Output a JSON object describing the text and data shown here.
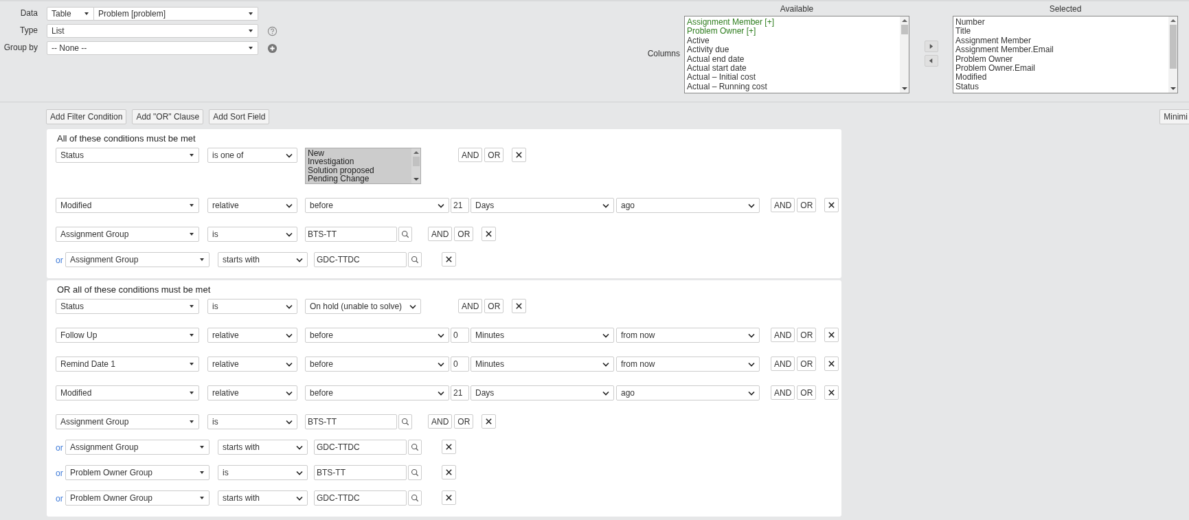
{
  "form": {
    "data": {
      "label": "Data",
      "source": "Table",
      "table": "Problem [problem]"
    },
    "type": {
      "label": "Type",
      "value": "List"
    },
    "group_by": {
      "label": "Group by",
      "value": "-- None --"
    }
  },
  "columns": {
    "label": "Columns",
    "available": {
      "title": "Available",
      "items": [
        {
          "text": "Assignment Member [+]",
          "expandable": true
        },
        {
          "text": "Problem Owner [+]",
          "expandable": true
        },
        {
          "text": "Active",
          "expandable": false
        },
        {
          "text": "Activity due",
          "expandable": false
        },
        {
          "text": "Actual end date",
          "expandable": false
        },
        {
          "text": "Actual start date",
          "expandable": false
        },
        {
          "text": "Actual – Initial cost",
          "expandable": false
        },
        {
          "text": "Actual – Running cost",
          "expandable": false
        }
      ]
    },
    "selected": {
      "title": "Selected",
      "items": [
        "Number",
        "Title",
        "Assignment Member",
        "Assignment Member.Email",
        "Problem Owner",
        "Problem Owner.Email",
        "Modified",
        "Status"
      ]
    }
  },
  "toolbar": [
    "Add Filter Condition",
    "Add \"OR\" Clause",
    "Add Sort Field"
  ],
  "minimize": "Minimi",
  "blocks": [
    {
      "title": "All of these conditions must be met",
      "rows": [
        {
          "kind": "listbox",
          "field": "Status",
          "operator": "is one of",
          "options": [
            "New",
            "Investigation",
            "Solution proposed",
            "Pending Change"
          ],
          "actions": [
            "AND",
            "OR"
          ]
        },
        {
          "kind": "relative",
          "field": "Modified",
          "operator": "relative",
          "direction": "before",
          "amount": "21",
          "unit": "Days",
          "when": "ago",
          "actions": [
            "AND",
            "OR"
          ]
        },
        {
          "kind": "reference",
          "field": "Assignment Group",
          "operator": "is",
          "value": "BTS-TT",
          "actions": [
            "AND",
            "OR"
          ]
        },
        {
          "kind": "reference",
          "prefix": "or",
          "field": "Assignment Group",
          "operator": "starts with",
          "value": "GDC-TTDC"
        }
      ]
    },
    {
      "title": "OR all of these conditions must be met",
      "rows": [
        {
          "kind": "choice",
          "field": "Status",
          "operator": "is",
          "value": "On hold (unable to solve)",
          "actions": [
            "AND",
            "OR"
          ]
        },
        {
          "kind": "relative",
          "field": "Follow Up",
          "operator": "relative",
          "direction": "before",
          "amount": "0",
          "unit": "Minutes",
          "when": "from now",
          "actions": [
            "AND",
            "OR"
          ]
        },
        {
          "kind": "relative",
          "field": "Remind Date 1",
          "operator": "relative",
          "direction": "before",
          "amount": "0",
          "unit": "Minutes",
          "when": "from now",
          "actions": [
            "AND",
            "OR"
          ]
        },
        {
          "kind": "relative",
          "field": "Modified",
          "operator": "relative",
          "direction": "before",
          "amount": "21",
          "unit": "Days",
          "when": "ago",
          "actions": [
            "AND",
            "OR"
          ]
        },
        {
          "kind": "reference",
          "field": "Assignment Group",
          "operator": "is",
          "value": "BTS-TT",
          "actions": [
            "AND",
            "OR"
          ]
        },
        {
          "kind": "reference",
          "prefix": "or",
          "field": "Assignment Group",
          "operator": "starts with",
          "value": "GDC-TTDC"
        },
        {
          "kind": "reference",
          "prefix": "or",
          "field": "Problem Owner Group",
          "operator": "is",
          "value": "BTS-TT"
        },
        {
          "kind": "reference",
          "prefix": "or",
          "field": "Problem Owner Group",
          "operator": "starts with",
          "value": "GDC-TTDC"
        }
      ]
    }
  ]
}
